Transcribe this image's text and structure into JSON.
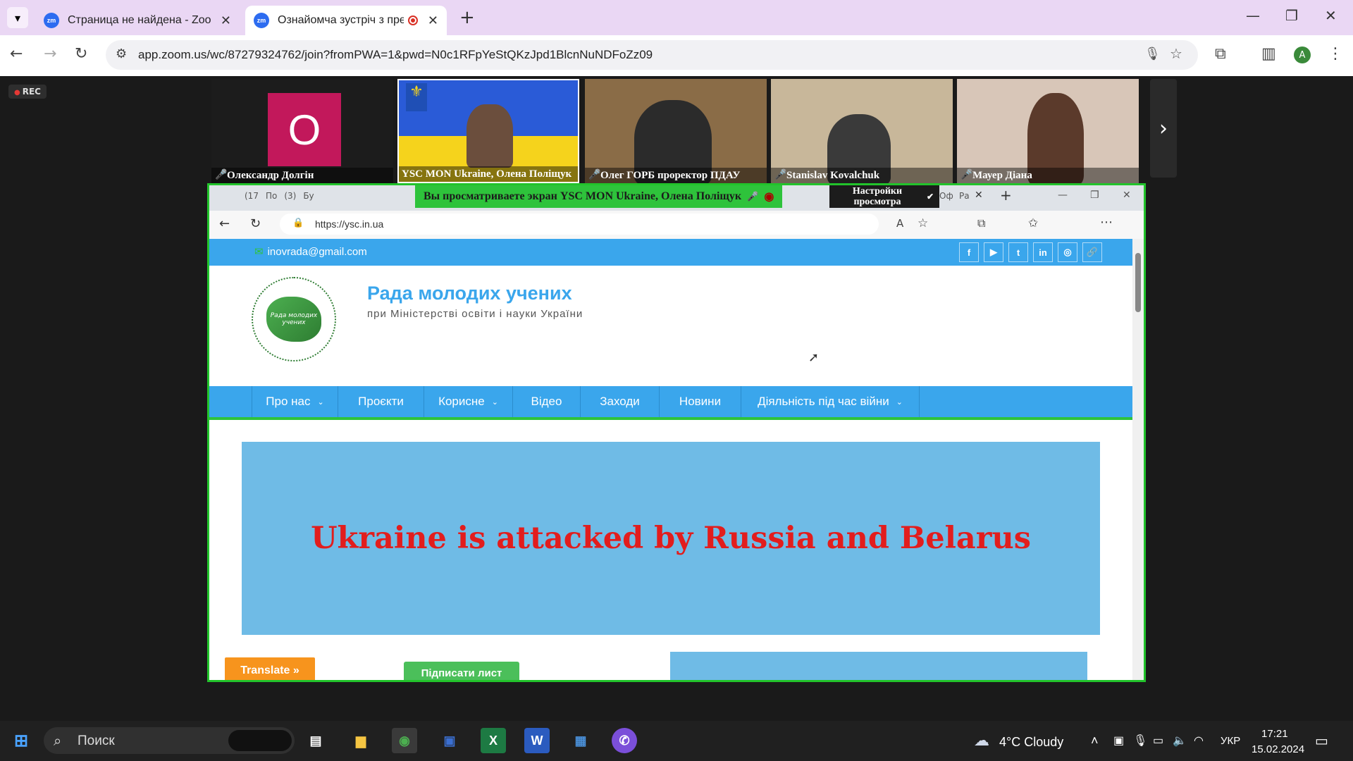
{
  "browser": {
    "tabs": [
      {
        "title": "Страница не найдена - Zoom",
        "icon": "zm"
      },
      {
        "title": "Ознайомча зустріч з пред",
        "icon": "zm",
        "recording": true
      }
    ],
    "new_tab": "+",
    "url": "app.zoom.us/wc/87279324762/join?fromPWA=1&pwd=N0c1RFpYeStQKzJpd1BlcnNuNDFoZz09",
    "profile_initial": "A"
  },
  "zoom": {
    "rec_label": "REC",
    "participants": [
      {
        "name": "Олександр Долгін",
        "avatar_letter": "O"
      },
      {
        "name": "YSC MON Ukraine, Олена Поліщук"
      },
      {
        "name": "Олег ГОРБ проректор ПДАУ"
      },
      {
        "name": "Stanislav Kovalchuk"
      },
      {
        "name": "Мауер Діана"
      }
    ],
    "viewing_banner": "Вы просматриваете экран  YSC MON Ukraine, Олена Поліщук",
    "view_settings": "Настройки просмотра"
  },
  "shared": {
    "edge_url": "https://ysc.in.ua",
    "edge_tab_labels": [
      "(17",
      "По",
      "(3)",
      "Бу",
      "Оф",
      "Ра"
    ],
    "email": "inovrada@gmail.com",
    "social": [
      "f",
      "▶",
      "t",
      "in",
      "◎",
      "🔗"
    ],
    "logo_text": "Рада молодих учених",
    "site_title": "Рада молодих учених",
    "site_subtitle": "при Міністерстві освіти і науки України",
    "nav": [
      "Про нас",
      "Проєкти",
      "Корисне",
      "Відео",
      "Заходи",
      "Новини",
      "Діяльність під час війни"
    ],
    "banner": "Ukraine is attacked by Russia and Belarus",
    "translate": "Translate »",
    "sign": "Підписати лист"
  },
  "taskbar": {
    "search": "Поиск",
    "weather": "4°C  Cloudy",
    "lang": "УКР",
    "time": "17:21",
    "date": "15.02.2024"
  }
}
